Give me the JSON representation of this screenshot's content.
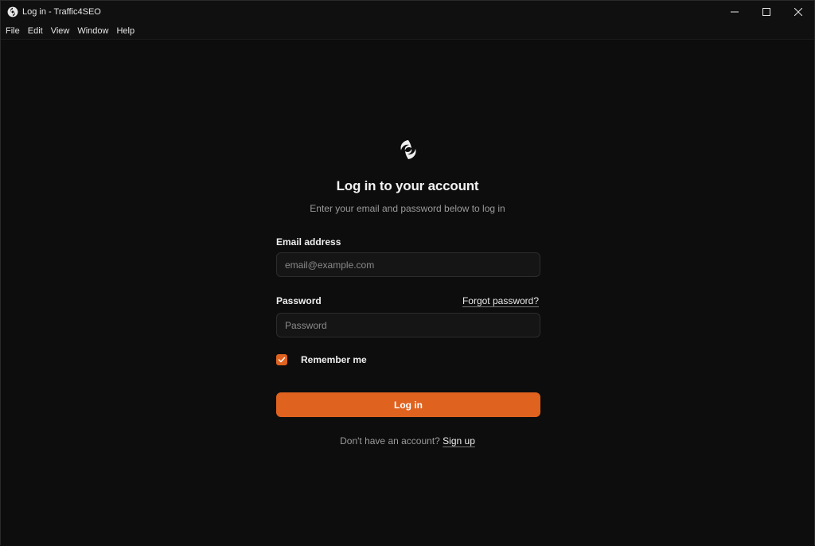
{
  "window": {
    "title": "Log in - Traffic4SEO",
    "controls": [
      "minimize-icon",
      "maximize-icon",
      "close-icon"
    ]
  },
  "menu": [
    "File",
    "Edit",
    "View",
    "Window",
    "Help"
  ],
  "login": {
    "heading": "Log in to your account",
    "subheading": "Enter your email and password below to log in",
    "email_label": "Email address",
    "email_placeholder": "email@example.com",
    "email_value": "",
    "password_label": "Password",
    "password_placeholder": "Password",
    "password_value": "",
    "forgot_link": "Forgot password?",
    "remember_label": "Remember me",
    "remember_checked": true,
    "login_button": "Log in",
    "signup_prompt": "Don't have an account?",
    "signup_link": "Sign up"
  },
  "colors": {
    "accent": "#e0621f",
    "background": "#0d0d0d",
    "input_bg": "#151515"
  },
  "icons": {
    "app": "swirl-logo-icon",
    "checkbox": "checkmark-icon"
  }
}
